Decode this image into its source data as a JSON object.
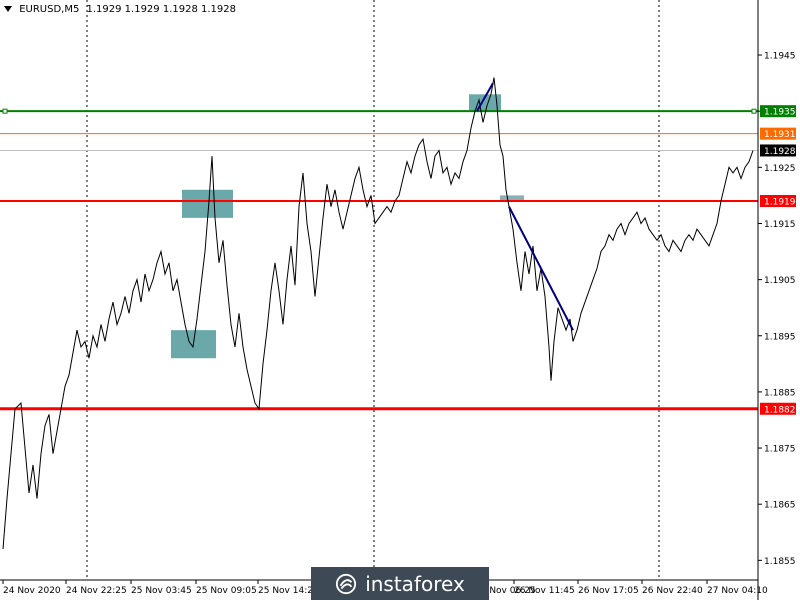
{
  "header": {
    "symbol": "EURUSD,M5",
    "ohlc": "1.1929 1.1929 1.1928 1.1928"
  },
  "watermark": {
    "text": "instaforex"
  },
  "chart_data": {
    "type": "line",
    "y_ticks": [
      "1.1945",
      "1.1935",
      "1.1925",
      "1.1915",
      "1.1905",
      "1.1895",
      "1.1885",
      "1.1875",
      "1.1865",
      "1.1855"
    ],
    "x_ticks": [
      "24 Nov 2020",
      "24 Nov 22:25",
      "25 Nov 03:45",
      "25 Nov 09:05",
      "25 Nov 14:25",
      "26 Nov 06:25",
      "26 Nov 11:45",
      "26 Nov 17:05",
      "26 Nov 22:40",
      "27 Nov 04:10"
    ],
    "ylim": [
      1.18515,
      1.19548
    ],
    "levels": [
      {
        "value": 1.1935,
        "label": "1.1935",
        "color": "#008000"
      },
      {
        "value": 1.1931,
        "label": "1.1931",
        "color": "#ff6a00"
      },
      {
        "value": 1.1928,
        "label": "1.1928",
        "color": "#808080"
      },
      {
        "value": 1.1919,
        "label": "1.1919",
        "color": "#ff0000"
      },
      {
        "value": 1.1882,
        "label": "1.1882",
        "color": "#ff0000"
      }
    ],
    "price": [
      [
        0,
        1.1857
      ],
      [
        4,
        1.1866
      ],
      [
        8,
        1.1874
      ],
      [
        12,
        1.1882
      ],
      [
        18,
        1.1883
      ],
      [
        22,
        1.1875
      ],
      [
        26,
        1.1867
      ],
      [
        30,
        1.1872
      ],
      [
        34,
        1.1866
      ],
      [
        38,
        1.1874
      ],
      [
        42,
        1.1879
      ],
      [
        46,
        1.1881
      ],
      [
        50,
        1.1874
      ],
      [
        54,
        1.1878
      ],
      [
        58,
        1.1882
      ],
      [
        62,
        1.1886
      ],
      [
        66,
        1.1888
      ],
      [
        70,
        1.1892
      ],
      [
        74,
        1.1896
      ],
      [
        78,
        1.1893
      ],
      [
        82,
        1.1894
      ],
      [
        86,
        1.1891
      ],
      [
        90,
        1.1895
      ],
      [
        94,
        1.1893
      ],
      [
        98,
        1.1897
      ],
      [
        102,
        1.1894
      ],
      [
        106,
        1.1898
      ],
      [
        110,
        1.1901
      ],
      [
        114,
        1.1897
      ],
      [
        118,
        1.1899
      ],
      [
        122,
        1.1902
      ],
      [
        126,
        1.1899
      ],
      [
        130,
        1.1903
      ],
      [
        134,
        1.1905
      ],
      [
        138,
        1.1901
      ],
      [
        142,
        1.1906
      ],
      [
        146,
        1.1903
      ],
      [
        150,
        1.1905
      ],
      [
        154,
        1.1908
      ],
      [
        158,
        1.191
      ],
      [
        162,
        1.1906
      ],
      [
        166,
        1.1908
      ],
      [
        170,
        1.1903
      ],
      [
        174,
        1.1905
      ],
      [
        178,
        1.1901
      ],
      [
        182,
        1.1897
      ],
      [
        186,
        1.1894
      ],
      [
        190,
        1.1893
      ],
      [
        194,
        1.1898
      ],
      [
        198,
        1.1904
      ],
      [
        202,
        1.191
      ],
      [
        206,
        1.1919
      ],
      [
        209,
        1.1927
      ],
      [
        212,
        1.1916
      ],
      [
        216,
        1.1908
      ],
      [
        220,
        1.1912
      ],
      [
        224,
        1.1904
      ],
      [
        228,
        1.1897
      ],
      [
        232,
        1.1893
      ],
      [
        236,
        1.1899
      ],
      [
        240,
        1.1893
      ],
      [
        244,
        1.1889
      ],
      [
        248,
        1.1886
      ],
      [
        252,
        1.1883
      ],
      [
        256,
        1.1882
      ],
      [
        260,
        1.189
      ],
      [
        264,
        1.1896
      ],
      [
        268,
        1.1903
      ],
      [
        272,
        1.1908
      ],
      [
        276,
        1.1903
      ],
      [
        280,
        1.1897
      ],
      [
        284,
        1.1905
      ],
      [
        288,
        1.1911
      ],
      [
        292,
        1.1904
      ],
      [
        296,
        1.1918
      ],
      [
        300,
        1.1924
      ],
      [
        304,
        1.1915
      ],
      [
        308,
        1.191
      ],
      [
        312,
        1.1902
      ],
      [
        316,
        1.1909
      ],
      [
        320,
        1.1916
      ],
      [
        324,
        1.1922
      ],
      [
        328,
        1.1918
      ],
      [
        332,
        1.1921
      ],
      [
        336,
        1.1917
      ],
      [
        340,
        1.1914
      ],
      [
        344,
        1.1917
      ],
      [
        348,
        1.192
      ],
      [
        352,
        1.1923
      ],
      [
        356,
        1.1925
      ],
      [
        360,
        1.1921
      ],
      [
        364,
        1.1918
      ],
      [
        368,
        1.192
      ],
      [
        372,
        1.1915
      ],
      [
        376,
        1.1916
      ],
      [
        380,
        1.1917
      ],
      [
        384,
        1.1918
      ],
      [
        388,
        1.1917
      ],
      [
        392,
        1.1919
      ],
      [
        396,
        1.192
      ],
      [
        400,
        1.1923
      ],
      [
        404,
        1.1926
      ],
      [
        408,
        1.1924
      ],
      [
        412,
        1.1927
      ],
      [
        416,
        1.1929
      ],
      [
        420,
        1.193
      ],
      [
        424,
        1.1926
      ],
      [
        428,
        1.1923
      ],
      [
        432,
        1.1927
      ],
      [
        436,
        1.1928
      ],
      [
        440,
        1.1924
      ],
      [
        444,
        1.1925
      ],
      [
        448,
        1.1922
      ],
      [
        452,
        1.1924
      ],
      [
        456,
        1.1923
      ],
      [
        460,
        1.1926
      ],
      [
        464,
        1.1928
      ],
      [
        468,
        1.1932
      ],
      [
        472,
        1.1935
      ],
      [
        476,
        1.1937
      ],
      [
        480,
        1.1933
      ],
      [
        484,
        1.1936
      ],
      [
        488,
        1.1938
      ],
      [
        491,
        1.1941
      ],
      [
        494,
        1.1936
      ],
      [
        497,
        1.1929
      ],
      [
        500,
        1.1927
      ],
      [
        503,
        1.1921
      ],
      [
        506,
        1.1918
      ],
      [
        510,
        1.1914
      ],
      [
        514,
        1.1908
      ],
      [
        518,
        1.1903
      ],
      [
        522,
        1.191
      ],
      [
        526,
        1.1906
      ],
      [
        530,
        1.1911
      ],
      [
        534,
        1.1903
      ],
      [
        538,
        1.1907
      ],
      [
        542,
        1.1902
      ],
      [
        546,
        1.1893
      ],
      [
        548,
        1.1887
      ],
      [
        551,
        1.1894
      ],
      [
        555,
        1.19
      ],
      [
        559,
        1.1898
      ],
      [
        563,
        1.1896
      ],
      [
        567,
        1.1898
      ],
      [
        570,
        1.1894
      ],
      [
        574,
        1.1896
      ],
      [
        578,
        1.1899
      ],
      [
        582,
        1.1901
      ],
      [
        586,
        1.1903
      ],
      [
        590,
        1.1905
      ],
      [
        594,
        1.1907
      ],
      [
        598,
        1.191
      ],
      [
        602,
        1.1911
      ],
      [
        606,
        1.1913
      ],
      [
        610,
        1.1912
      ],
      [
        614,
        1.1914
      ],
      [
        618,
        1.1915
      ],
      [
        622,
        1.1913
      ],
      [
        626,
        1.1915
      ],
      [
        630,
        1.1916
      ],
      [
        634,
        1.1917
      ],
      [
        638,
        1.1915
      ],
      [
        642,
        1.1916
      ],
      [
        646,
        1.1914
      ],
      [
        650,
        1.1913
      ],
      [
        654,
        1.1912
      ],
      [
        658,
        1.1913
      ],
      [
        662,
        1.1911
      ],
      [
        666,
        1.191
      ],
      [
        670,
        1.1912
      ],
      [
        674,
        1.1911
      ],
      [
        678,
        1.191
      ],
      [
        682,
        1.1912
      ],
      [
        686,
        1.1913
      ],
      [
        690,
        1.1912
      ],
      [
        694,
        1.1914
      ],
      [
        698,
        1.1913
      ],
      [
        702,
        1.1912
      ],
      [
        706,
        1.1911
      ],
      [
        710,
        1.1913
      ],
      [
        714,
        1.1915
      ],
      [
        718,
        1.1919
      ],
      [
        722,
        1.1922
      ],
      [
        726,
        1.1925
      ],
      [
        730,
        1.1924
      ],
      [
        734,
        1.1925
      ],
      [
        738,
        1.1923
      ],
      [
        742,
        1.1925
      ],
      [
        746,
        1.1926
      ],
      [
        750,
        1.1928
      ]
    ],
    "zones": [
      {
        "t0": 179,
        "t1": 230,
        "p_hi": 1.1921,
        "p_lo": 1.1916,
        "color": "#5a9ea0"
      },
      {
        "t0": 168,
        "t1": 213,
        "p_hi": 1.1896,
        "p_lo": 1.1891,
        "color": "#5a9ea0"
      },
      {
        "t0": 466,
        "t1": 498,
        "p_hi": 1.1938,
        "p_lo": 1.1935,
        "color": "#5a9ea0"
      },
      {
        "t0": 497,
        "t1": 521,
        "p_hi": 1.192,
        "p_lo": 1.1919,
        "color": "#7fa6a8"
      }
    ],
    "trend_lines": [
      {
        "t0": 474,
        "p0": 1.1935,
        "t1": 490,
        "p1": 1.194,
        "color": "#000080"
      },
      {
        "t0": 506,
        "p0": 1.1918,
        "t1": 570,
        "p1": 1.1896,
        "color": "#000080"
      }
    ],
    "vgrid_x": [
      87,
      374,
      659
    ],
    "vgrid_x_light": [
      303,
      515
    ]
  }
}
